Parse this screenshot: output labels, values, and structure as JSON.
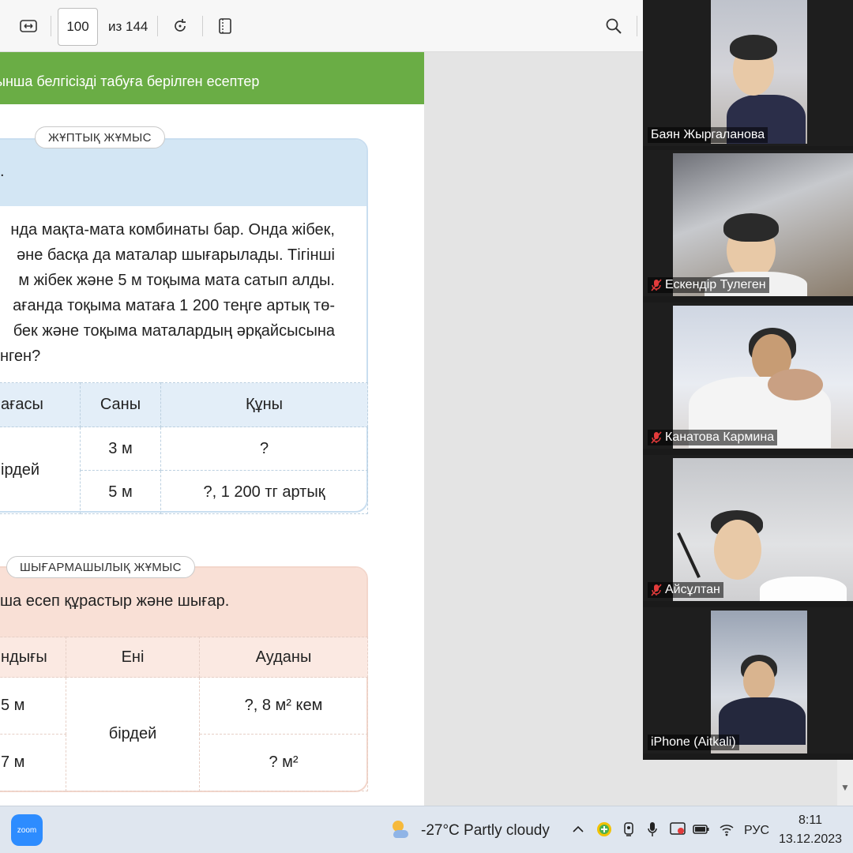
{
  "toolbar": {
    "page_number": "100",
    "page_total": "из 144"
  },
  "page": {
    "banner": "ынша белгісізді табуға берілген есептер",
    "pair_work_label": "ЖҰПТЫҚ ЖҰМЫС",
    "pair_head": ".",
    "paragraph_lines": [
      "нда мақта-мата комбинаты бар. Онда жібек,",
      "әне басқа да маталар шығарылады. Тігінші",
      "м жібек және 5 м тоқыма мата сатып алды.",
      "ағанда тоқыма матаға 1 200 теңге артық тө-",
      "бек және тоқыма маталардың әрқайсысына",
      "нген?"
    ],
    "table1": {
      "headers": [
        "ағасы",
        "Саны",
        "Құны"
      ],
      "merged_cell": "ірдей",
      "rows": [
        {
          "qty": "3 м",
          "cost": "?"
        },
        {
          "qty": "5 м",
          "cost": "?, 1 200 тг артық"
        }
      ]
    },
    "creative_label": "ШЫҒАРМАШЫЛЫҚ ЖҰМЫС",
    "creative_head": "ша есеп құрастыр және шығар.",
    "table2": {
      "headers": [
        "ндығы",
        "Ені",
        "Ауданы"
      ],
      "merged_cell": "бірдей",
      "rows": [
        {
          "length": "5 м",
          "area": "?, 8 м² кем"
        },
        {
          "length": "7 м",
          "area": "? м²"
        }
      ]
    }
  },
  "participants": [
    {
      "name": "Баян Жыргаланова",
      "muted": false
    },
    {
      "name": "Ескендір Тулеген",
      "muted": true
    },
    {
      "name": "Канатова Кармина",
      "muted": true
    },
    {
      "name": "Айсұлтан",
      "muted": true
    },
    {
      "name": "iPhone (Aitkali)",
      "muted": false
    }
  ],
  "taskbar": {
    "zoom_app_label": "zoom",
    "weather": "-27°C  Partly cloudy",
    "language": "РУС",
    "time": "8:11",
    "date": "13.12.2023"
  },
  "colors": {
    "banner": "#6aad45",
    "pair_card_head": "#d3e6f4",
    "creative_card_head": "#f9e0d6",
    "mute_icon": "#e23b3b",
    "zoom_blue": "#2d8cff"
  }
}
